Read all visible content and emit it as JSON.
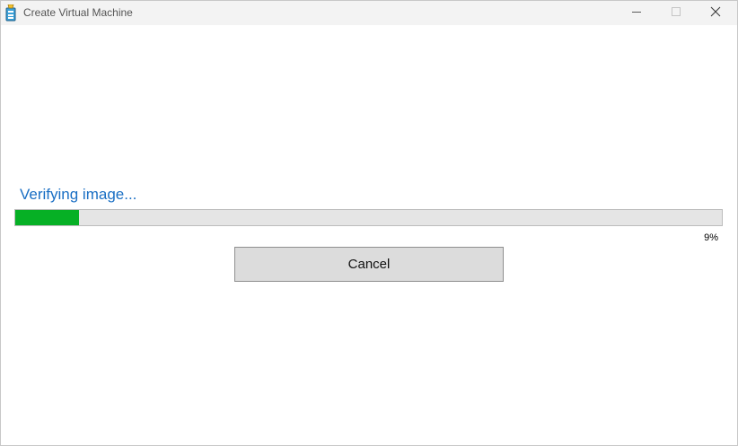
{
  "window": {
    "title": "Create Virtual Machine",
    "app_icon": "virtual-machine-app-icon",
    "controls": {
      "minimize_icon": "minimize-icon",
      "maximize_icon": "maximize-icon",
      "close_icon": "close-icon"
    }
  },
  "progress": {
    "status": "Verifying image...",
    "percent_label": "9%",
    "fraction": 0.09,
    "fill_color": "#06b025",
    "track_color": "#e5e5e5"
  },
  "actions": {
    "cancel_label": "Cancel"
  },
  "colors": {
    "status_text": "#1a6fc4",
    "titlebar": "#f3f3f3"
  }
}
